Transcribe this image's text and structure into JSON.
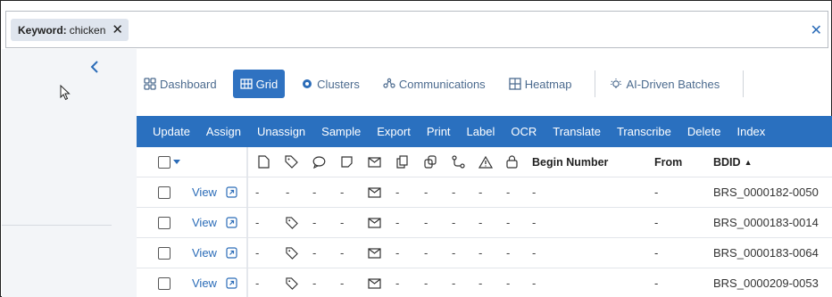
{
  "search": {
    "chip_label": "Keyword:",
    "chip_value": "chicken"
  },
  "tabs": [
    {
      "label": "Dashboard"
    },
    {
      "label": "Grid"
    },
    {
      "label": "Clusters"
    },
    {
      "label": "Communications"
    },
    {
      "label": "Heatmap"
    },
    {
      "label": "AI-Driven Batches"
    }
  ],
  "actions": [
    "Update",
    "Assign",
    "Unassign",
    "Sample",
    "Export",
    "Print",
    "Label",
    "OCR",
    "Translate",
    "Transcribe",
    "Delete",
    "Index"
  ],
  "columns": {
    "begin_number": "Begin Number",
    "from": "From",
    "bdid": "BDID",
    "bdid_sort": "▲"
  },
  "rows": [
    {
      "view": "View",
      "tag": "-",
      "begin": "-",
      "from": "-",
      "bdid": "BRS_0000182-0050"
    },
    {
      "view": "View",
      "tag": "tag",
      "begin": "-",
      "from": "-",
      "bdid": "BRS_0000183-0014"
    },
    {
      "view": "View",
      "tag": "tag",
      "begin": "-",
      "from": "-",
      "bdid": "BRS_0000183-0064"
    },
    {
      "view": "View",
      "tag": "tag",
      "begin": "-",
      "from": "-",
      "bdid": "BRS_0000209-0053"
    }
  ],
  "dash": "-",
  "colors": {
    "accent": "#2a70bf",
    "link": "#2b6cb8"
  }
}
